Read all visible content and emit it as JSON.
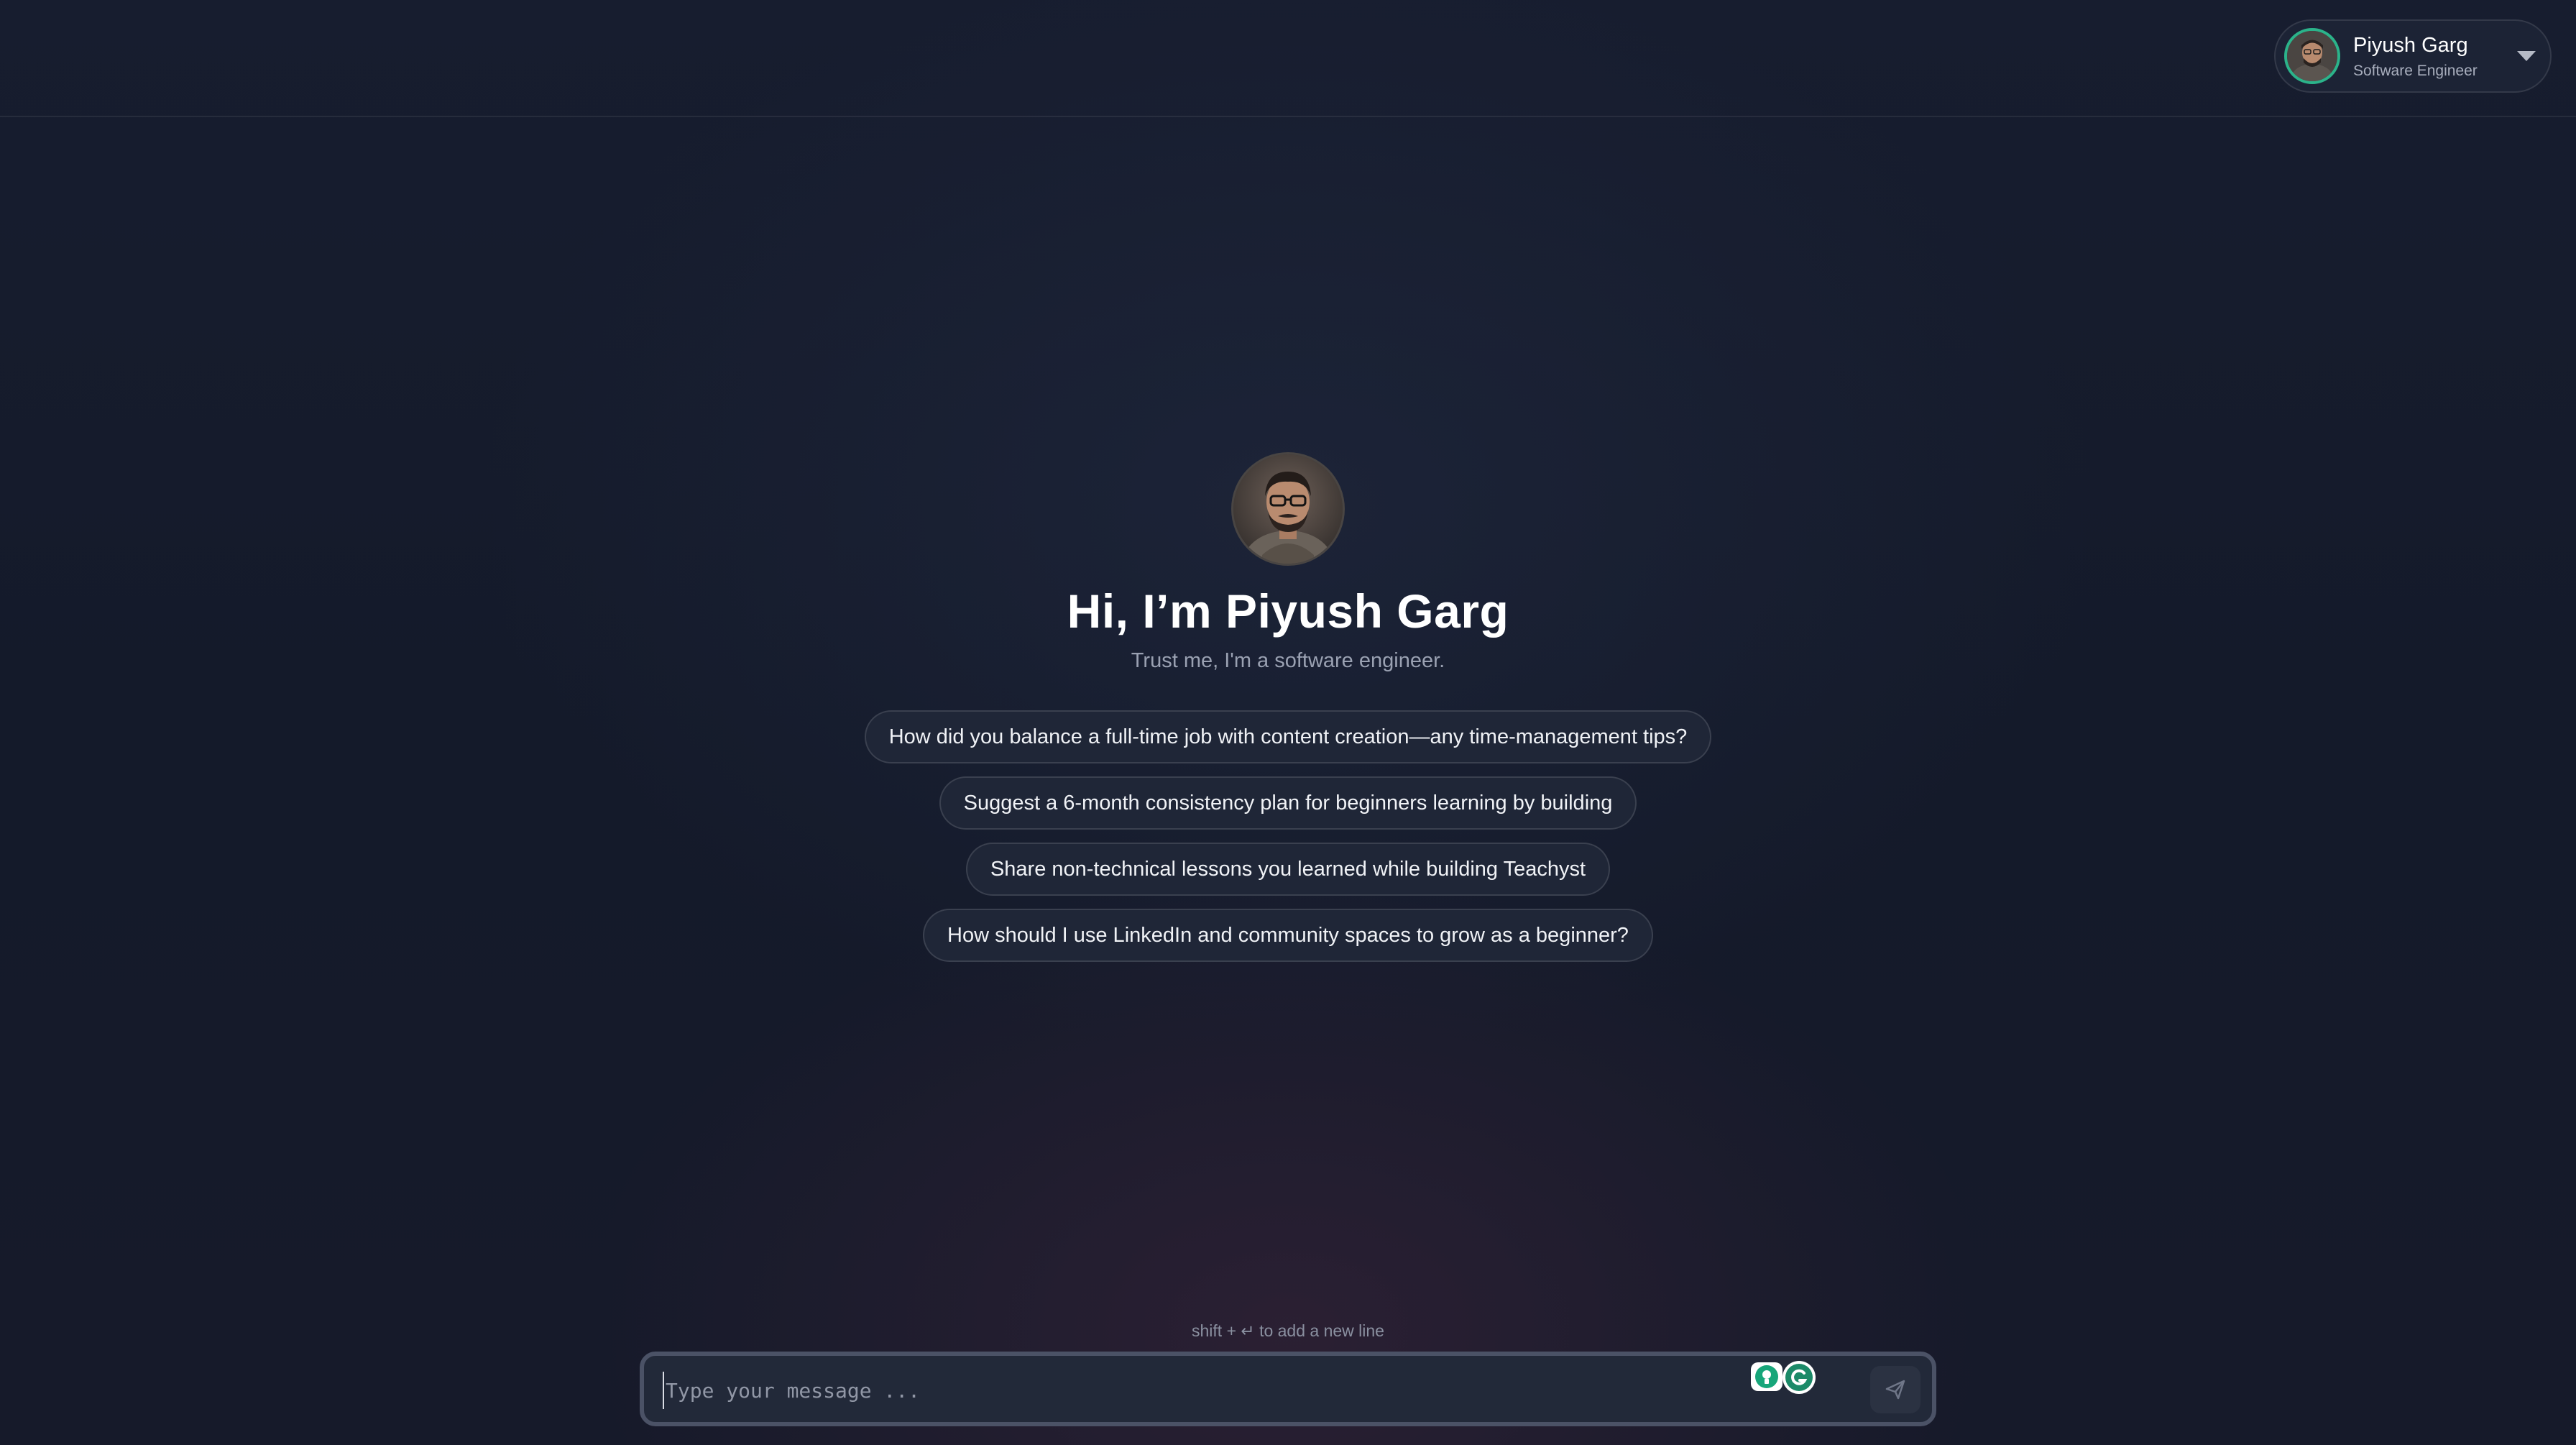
{
  "user_menu": {
    "name": "Piyush Garg",
    "role": "Software Engineer",
    "avatar_icon": "user-avatar",
    "dropdown_icon": "chevron-down-icon",
    "ring_color": "#2bb38a"
  },
  "hero": {
    "avatar_icon": "profile-photo",
    "title": "Hi, I’m Piyush Garg",
    "subtitle": "Trust me, I'm a software engineer."
  },
  "suggestions": [
    "How did you balance a full-time job with content creation—any time-management tips?",
    "Suggest a 6-month consistency plan for beginners learning by building",
    "Share non-technical lessons you learned while building Teachyst",
    "How should I use LinkedIn and community spaces to grow as a beginner?"
  ],
  "composer": {
    "hint": "shift + ↵ to add a new line",
    "placeholder": "Type your message ...",
    "value": "",
    "extension_icons": [
      "lightbulb-extension-icon",
      "grammarly-icon"
    ],
    "send_icon": "send-icon"
  },
  "colors": {
    "background": "#161b2c",
    "accent": "#2bb38a",
    "chip_background": "#1f2637"
  }
}
